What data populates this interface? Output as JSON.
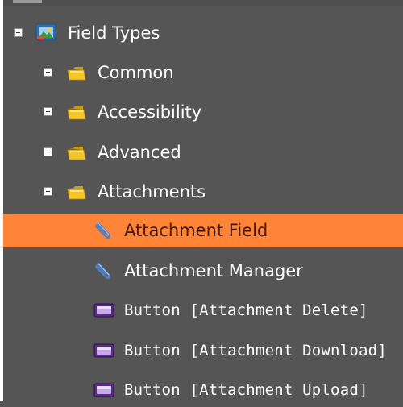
{
  "tree": {
    "root": {
      "label": "Field Types",
      "icon": "form-picture-icon",
      "expanded": true
    },
    "groups": [
      {
        "label": "Common",
        "icon": "folder-icon",
        "expanded": false
      },
      {
        "label": "Accessibility",
        "icon": "folder-icon",
        "expanded": false
      },
      {
        "label": "Advanced",
        "icon": "folder-icon",
        "expanded": false
      },
      {
        "label": "Attachments",
        "icon": "folder-icon",
        "expanded": true
      }
    ],
    "attachments_items": [
      {
        "label": "Attachment Field",
        "icon": "paperclip-icon",
        "selected": true
      },
      {
        "label": "Attachment Manager",
        "icon": "paperclip-icon",
        "selected": false
      },
      {
        "label": "Button [Attachment Delete]",
        "icon": "button-icon",
        "selected": false
      },
      {
        "label": "Button [Attachment Download]",
        "icon": "button-icon",
        "selected": false
      },
      {
        "label": "Button [Attachment Upload]",
        "icon": "button-icon",
        "selected": false
      }
    ]
  },
  "colors": {
    "background": "#555555",
    "selection": "#ff8438",
    "text": "#ffffff",
    "selected_text": "#4a1a00"
  }
}
